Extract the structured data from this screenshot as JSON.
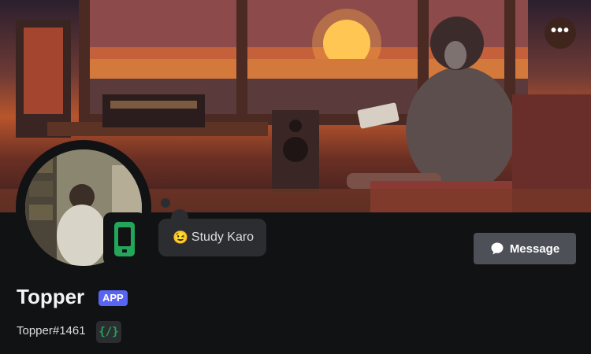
{
  "profile": {
    "display_name": "Topper",
    "app_tag": "APP",
    "username": "Topper#1461",
    "custom_status": {
      "emoji": "😉",
      "text": "Study Karo"
    },
    "status": "online-mobile",
    "dev_badge": "{/}"
  },
  "actions": {
    "message_label": "Message",
    "more_label": "•••"
  },
  "colors": {
    "background": "#111214",
    "app_tag": "#5865f2",
    "online_green": "#23a55a",
    "message_button": "#4e5058",
    "status_bubble": "#2b2d31"
  },
  "icons": {
    "more": "more-dots-icon",
    "message": "chat-bubble-icon",
    "mobile_status": "mobile-phone-icon",
    "dev_badge": "code-braces-icon"
  }
}
